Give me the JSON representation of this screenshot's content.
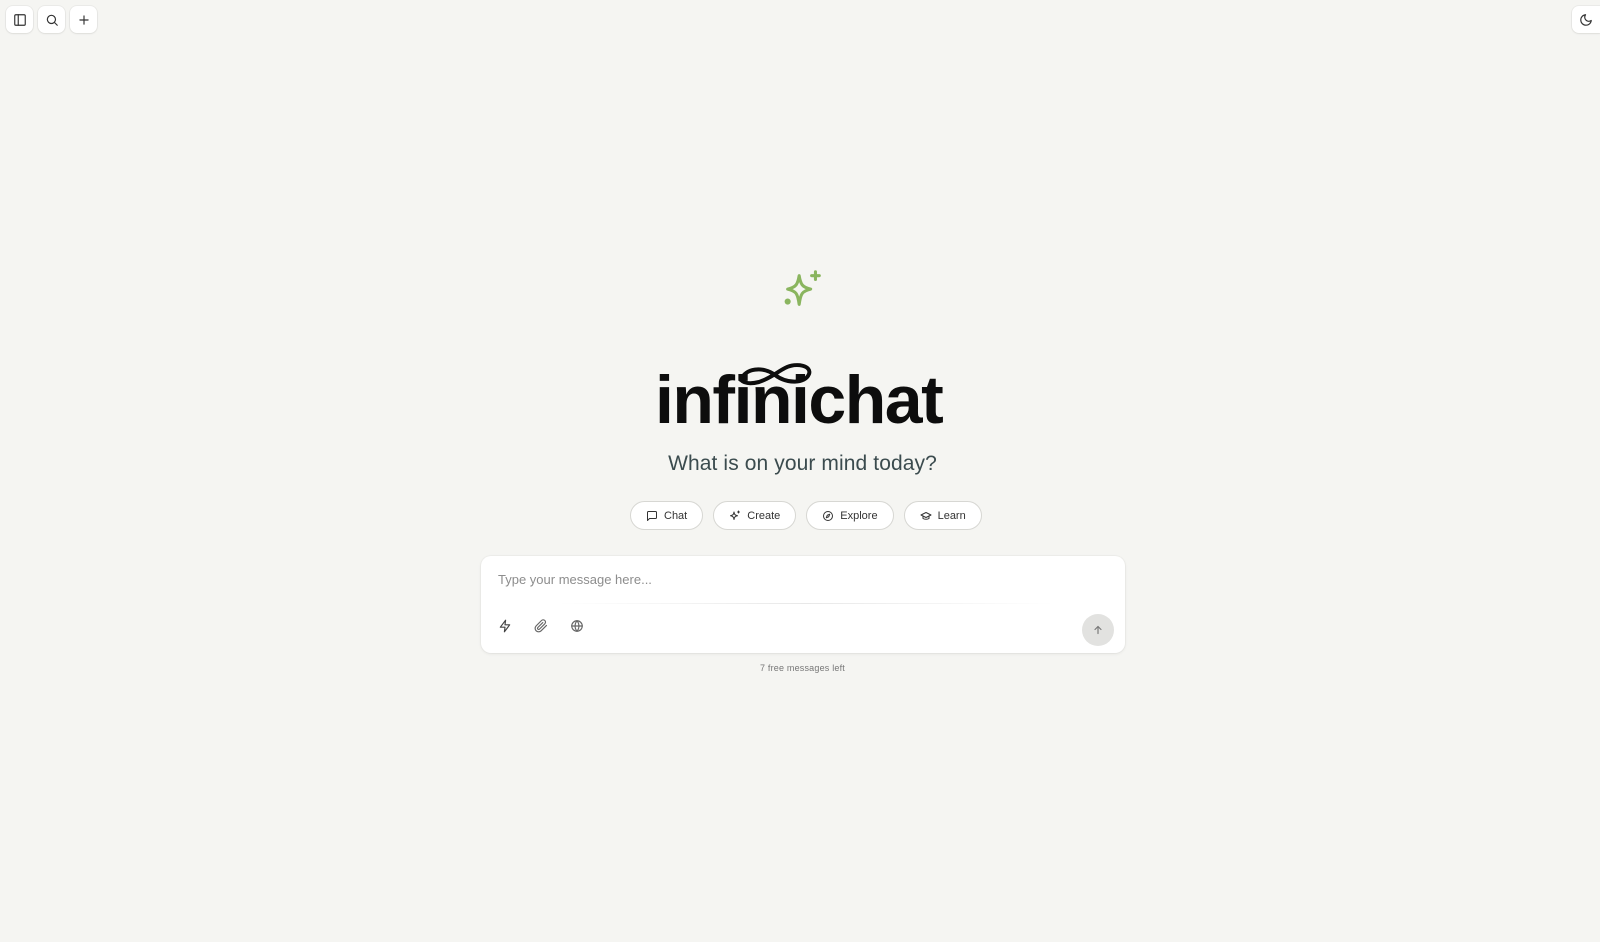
{
  "toolbar": {
    "left_icons": [
      "sidebar-toggle-icon",
      "search-icon",
      "plus-icon"
    ],
    "right_icon": "moon-icon"
  },
  "hero": {
    "sparkle_icon": "sparkle-icon",
    "logo_text": "infinichat",
    "logo_icon": "infinity-icon",
    "tagline": "What is on your mind today?",
    "accent_color": "#8ab55f"
  },
  "chips": [
    {
      "label": "Chat",
      "icon": "message-square-icon"
    },
    {
      "label": "Create",
      "icon": "sparkles-icon"
    },
    {
      "label": "Explore",
      "icon": "compass-icon"
    },
    {
      "label": "Learn",
      "icon": "graduation-cap-icon"
    }
  ],
  "composer": {
    "placeholder": "Type your message here...",
    "value": "",
    "tools": [
      "zap-icon",
      "paperclip-icon",
      "globe-icon"
    ],
    "send_icon": "arrow-up-icon"
  },
  "footer": {
    "remaining_text": "7 free messages left"
  }
}
